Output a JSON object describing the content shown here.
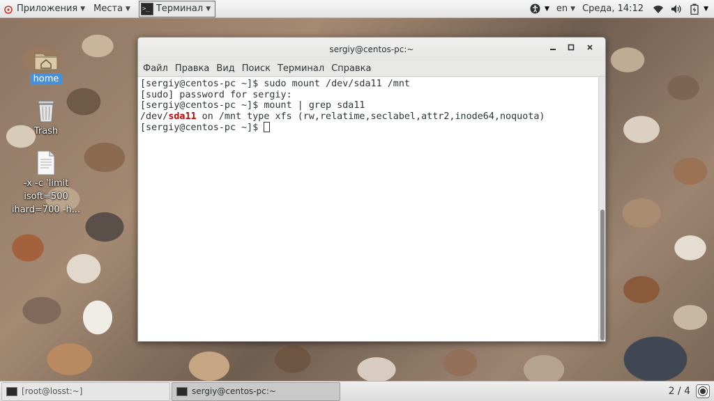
{
  "top_panel": {
    "apps_label": "Приложения",
    "places_label": "Места",
    "terminal_label": "Терминал",
    "lang": "en",
    "clock": "Среда, 14:12"
  },
  "desktop_icons": [
    {
      "label": "home",
      "icon": "home-folder-icon"
    },
    {
      "label": "Trash",
      "icon": "trash-icon"
    },
    {
      "label": "-x -c 'limit isoft=500 ihard=700 -h...",
      "icon": "text-file-icon"
    }
  ],
  "window": {
    "title": "sergiy@centos-pc:~",
    "menu": [
      "Файл",
      "Правка",
      "Вид",
      "Поиск",
      "Терминал",
      "Справка"
    ]
  },
  "terminal": {
    "line1": "[sergiy@centos-pc ~]$ sudo mount /dev/sda11 /mnt",
    "line2": "[sudo] password for sergiy:",
    "line3": "[sergiy@centos-pc ~]$ mount | grep sda11",
    "line4_pre": "/dev/",
    "line4_hl": "sda11",
    "line4_post": " on /mnt type xfs (rw,relatime,seclabel,attr2,inode64,noquota)",
    "line5": "[sergiy@centos-pc ~]$ "
  },
  "taskbar": {
    "tasks": [
      {
        "label": "[root@losst:~]",
        "active": false
      },
      {
        "label": "sergiy@centos-pc:~",
        "active": true
      }
    ],
    "workspace": "2 / 4"
  },
  "colors": {
    "highlight": "#cc0000",
    "selection": "#4a90d9"
  }
}
